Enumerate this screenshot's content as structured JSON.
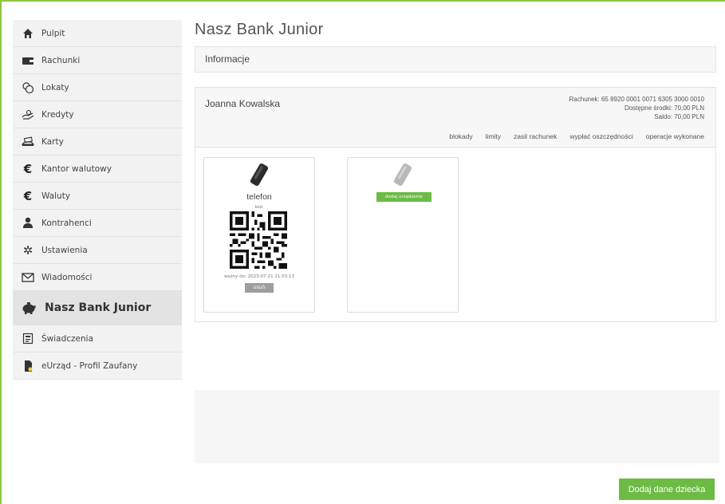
{
  "sidebar": {
    "items": [
      {
        "label": "Pulpit",
        "icon": "home-icon"
      },
      {
        "label": "Rachunki",
        "icon": "wallet-icon"
      },
      {
        "label": "Lokaty",
        "icon": "coins-icon"
      },
      {
        "label": "Kredyty",
        "icon": "loan-icon"
      },
      {
        "label": "Karty",
        "icon": "card-icon"
      },
      {
        "label": "Kantor walutowy",
        "icon": "euro-icon"
      },
      {
        "label": "Waluty",
        "icon": "euro-icon"
      },
      {
        "label": "Kontrahenci",
        "icon": "person-icon"
      },
      {
        "label": "Ustawienia",
        "icon": "gear-icon"
      },
      {
        "label": "Wiadomości",
        "icon": "envelope-icon"
      },
      {
        "label": "Nasz Bank Junior",
        "icon": "piggy-bank-icon",
        "active": true
      },
      {
        "label": "Świadczenia",
        "icon": "benefits-icon"
      },
      {
        "label": "eUrząd - Profil Zaufany",
        "icon": "document-icon"
      }
    ]
  },
  "main": {
    "title": "Nasz Bank Junior",
    "info_panel_title": "Informacje",
    "account": {
      "owner": "Joanna Kowalska",
      "account_line": "Rachunek: 65 8920 0001 0071 6305 3000 0010",
      "available_line": "Dostępne środki: 70,00 PLN",
      "balance_line": "Saldo: 70,00 PLN",
      "links": [
        "blokady",
        "limity",
        "zasil rachunek",
        "wypłać oszczędności",
        "operacje wykonane"
      ]
    },
    "devices": {
      "device_name": "telefon",
      "code_label": "kod:",
      "valid_until": "ważny do:  2023-07-21 21:03:13",
      "remove_label": "usuń",
      "add_device_label": "dodaj urządzenie"
    },
    "add_child_button": "Dodaj dane dziecka"
  },
  "colors": {
    "accent_green": "#6dbb45",
    "frame_green": "#8cc63f",
    "sidebar_bg": "#f2f2f2",
    "sidebar_active_bg": "#e3e3e3"
  }
}
